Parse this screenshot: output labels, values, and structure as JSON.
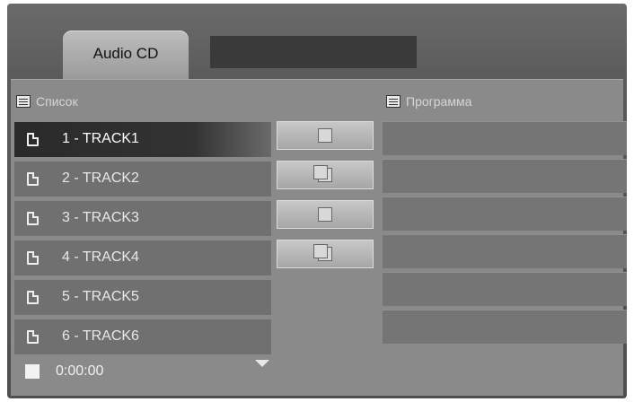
{
  "tab": {
    "label": "Audio CD"
  },
  "list": {
    "title": "Список",
    "items": [
      "1 - TRACK1",
      "2 - TRACK2",
      "3 - TRACK3",
      "4 - TRACK4",
      "5 - TRACK5",
      "6 - TRACK6"
    ],
    "selected_index": 0
  },
  "program": {
    "title": "Программа",
    "rows": 6
  },
  "status": {
    "time": "0:00:00"
  },
  "buttons": [
    {
      "icon": "add-track-icon"
    },
    {
      "icon": "add-all-tracks-icon"
    },
    {
      "icon": "remove-track-icon"
    },
    {
      "icon": "remove-all-tracks-icon"
    }
  ]
}
